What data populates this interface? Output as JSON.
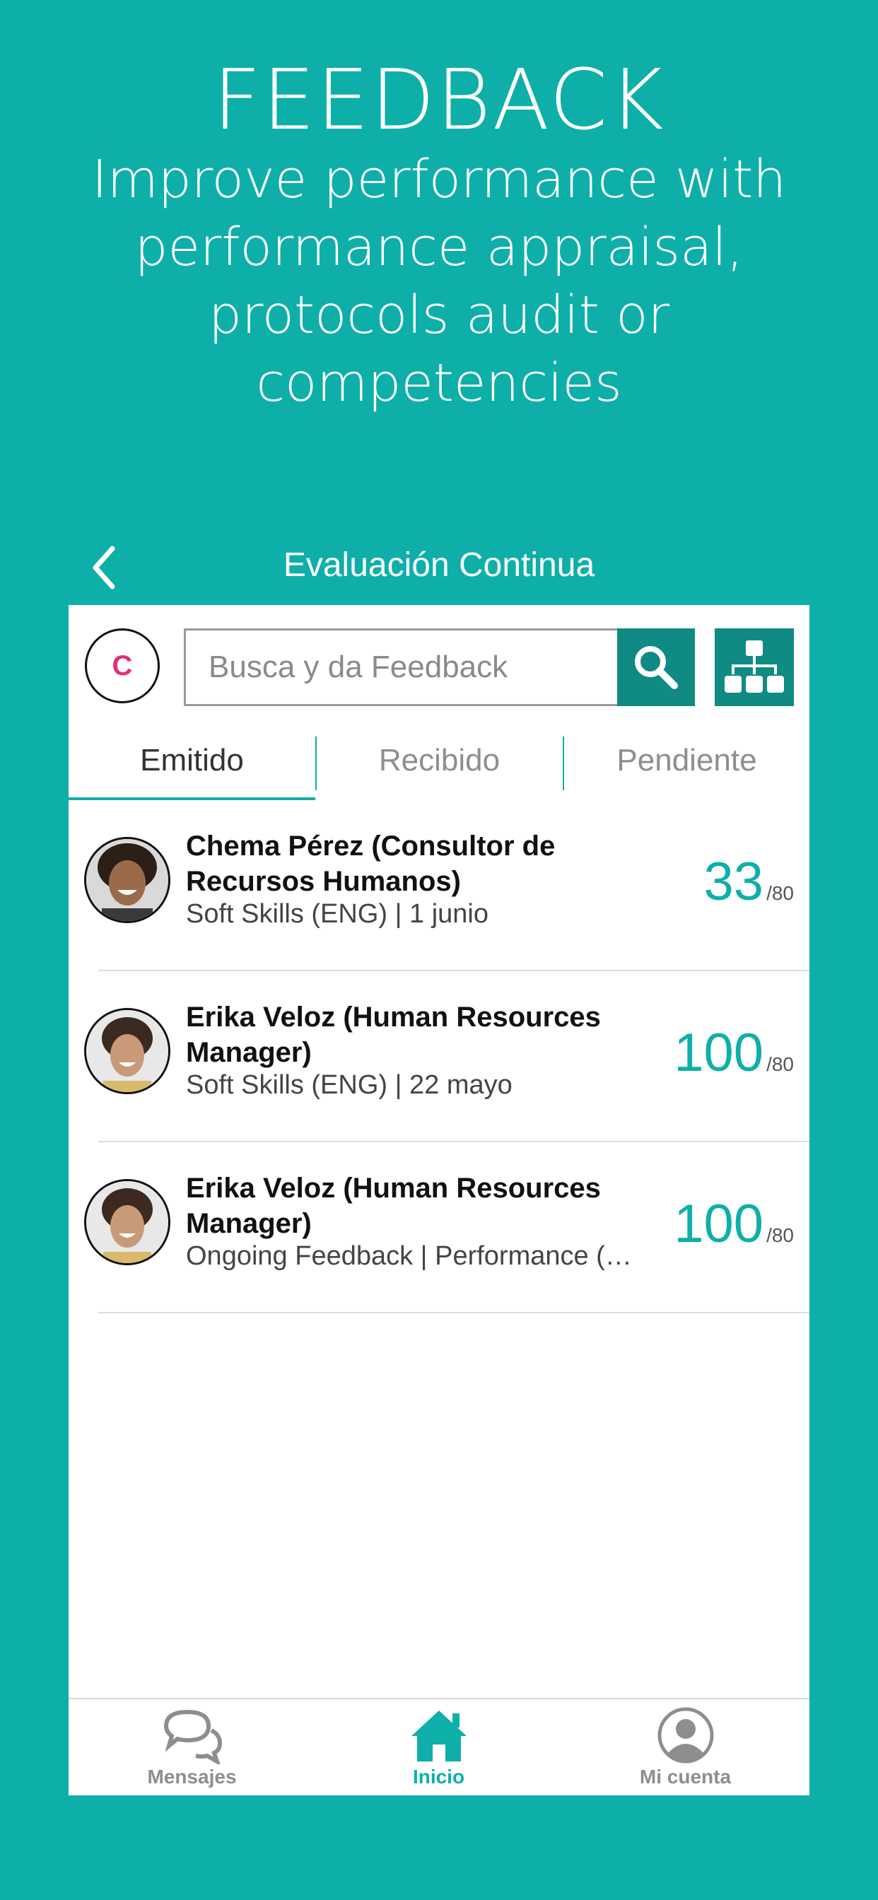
{
  "promo": {
    "title": "FEEDBACK",
    "subtitle": "Improve performance with performance appraisal, protocols audit or competencies"
  },
  "navbar": {
    "title": "Evaluación Continua",
    "back_icon": "chevron-left-icon"
  },
  "search": {
    "logo_letter": "C",
    "placeholder": "Busca y da Feedback",
    "search_icon": "search-icon",
    "org_icon": "org-chart-icon"
  },
  "tabs": [
    {
      "label": "Emitido",
      "active": true
    },
    {
      "label": "Recibido",
      "active": false
    },
    {
      "label": "Pendiente",
      "active": false
    }
  ],
  "items": [
    {
      "name": "Chema Pérez (Consultor de Recursos Humanos)",
      "meta": "Soft Skills  (ENG) | 1 junio",
      "score": "33",
      "max": "/80"
    },
    {
      "name": "Erika Veloz (Human Resources Manager)",
      "meta": "Soft Skills  (ENG) | 22 mayo",
      "score": "100",
      "max": "/80"
    },
    {
      "name": "Erika Veloz (Human Resources Manager)",
      "meta": "Ongoing Feedback | Performance (ENG)",
      "score": "100",
      "max": "/80"
    }
  ],
  "bottom_nav": [
    {
      "label": "Mensajes",
      "icon": "chat-bubbles-icon",
      "active": false
    },
    {
      "label": "Inicio",
      "icon": "home-icon",
      "active": true
    },
    {
      "label": "Mi cuenta",
      "icon": "user-account-icon",
      "active": false
    }
  ],
  "colors": {
    "accent": "#0eafa9",
    "dark_accent": "#0f8b83",
    "background": "#0eafa9"
  }
}
